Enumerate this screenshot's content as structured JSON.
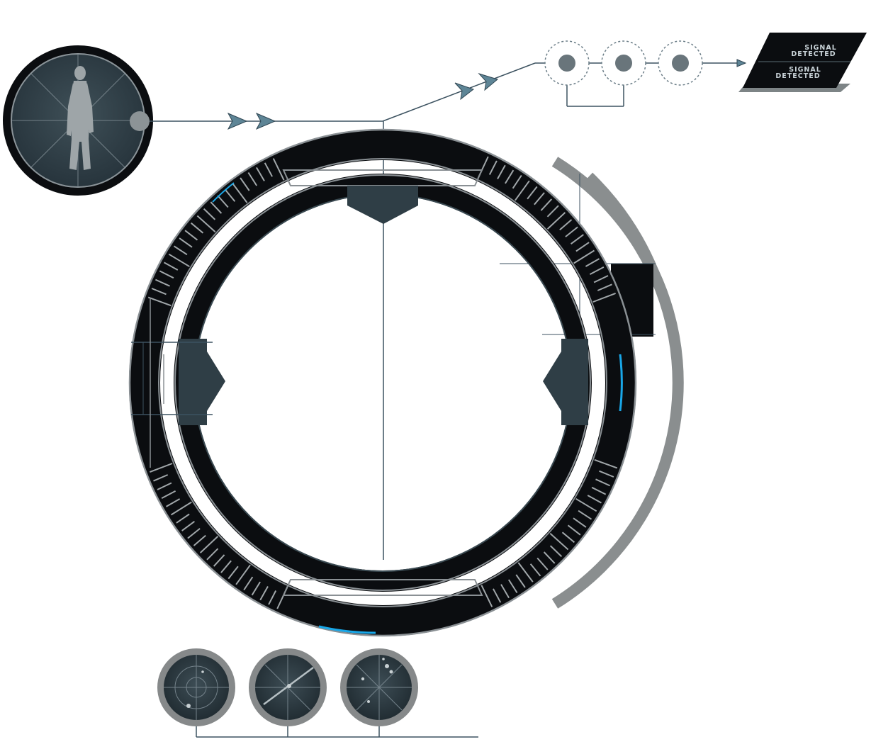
{
  "badge": {
    "line1_top": "SIGNAL",
    "line1_bottom": "DETECTED",
    "line2_top": "SIGNAL",
    "line2_bottom": "DETECTED"
  },
  "colors": {
    "ink": "#0b0d10",
    "panel": "#2f3e46",
    "ring_grey": "#8a8e8f",
    "line": "#3c5260",
    "accent_blue": "#19a7e8",
    "arrow": "#5e8596",
    "figure": "#9ea5a8"
  },
  "icons": {
    "portrait": "human-silhouette-icon",
    "nodes": "target-node-icon",
    "arrows": "direction-arrow-icon",
    "radars": "radar-scope-icon"
  }
}
